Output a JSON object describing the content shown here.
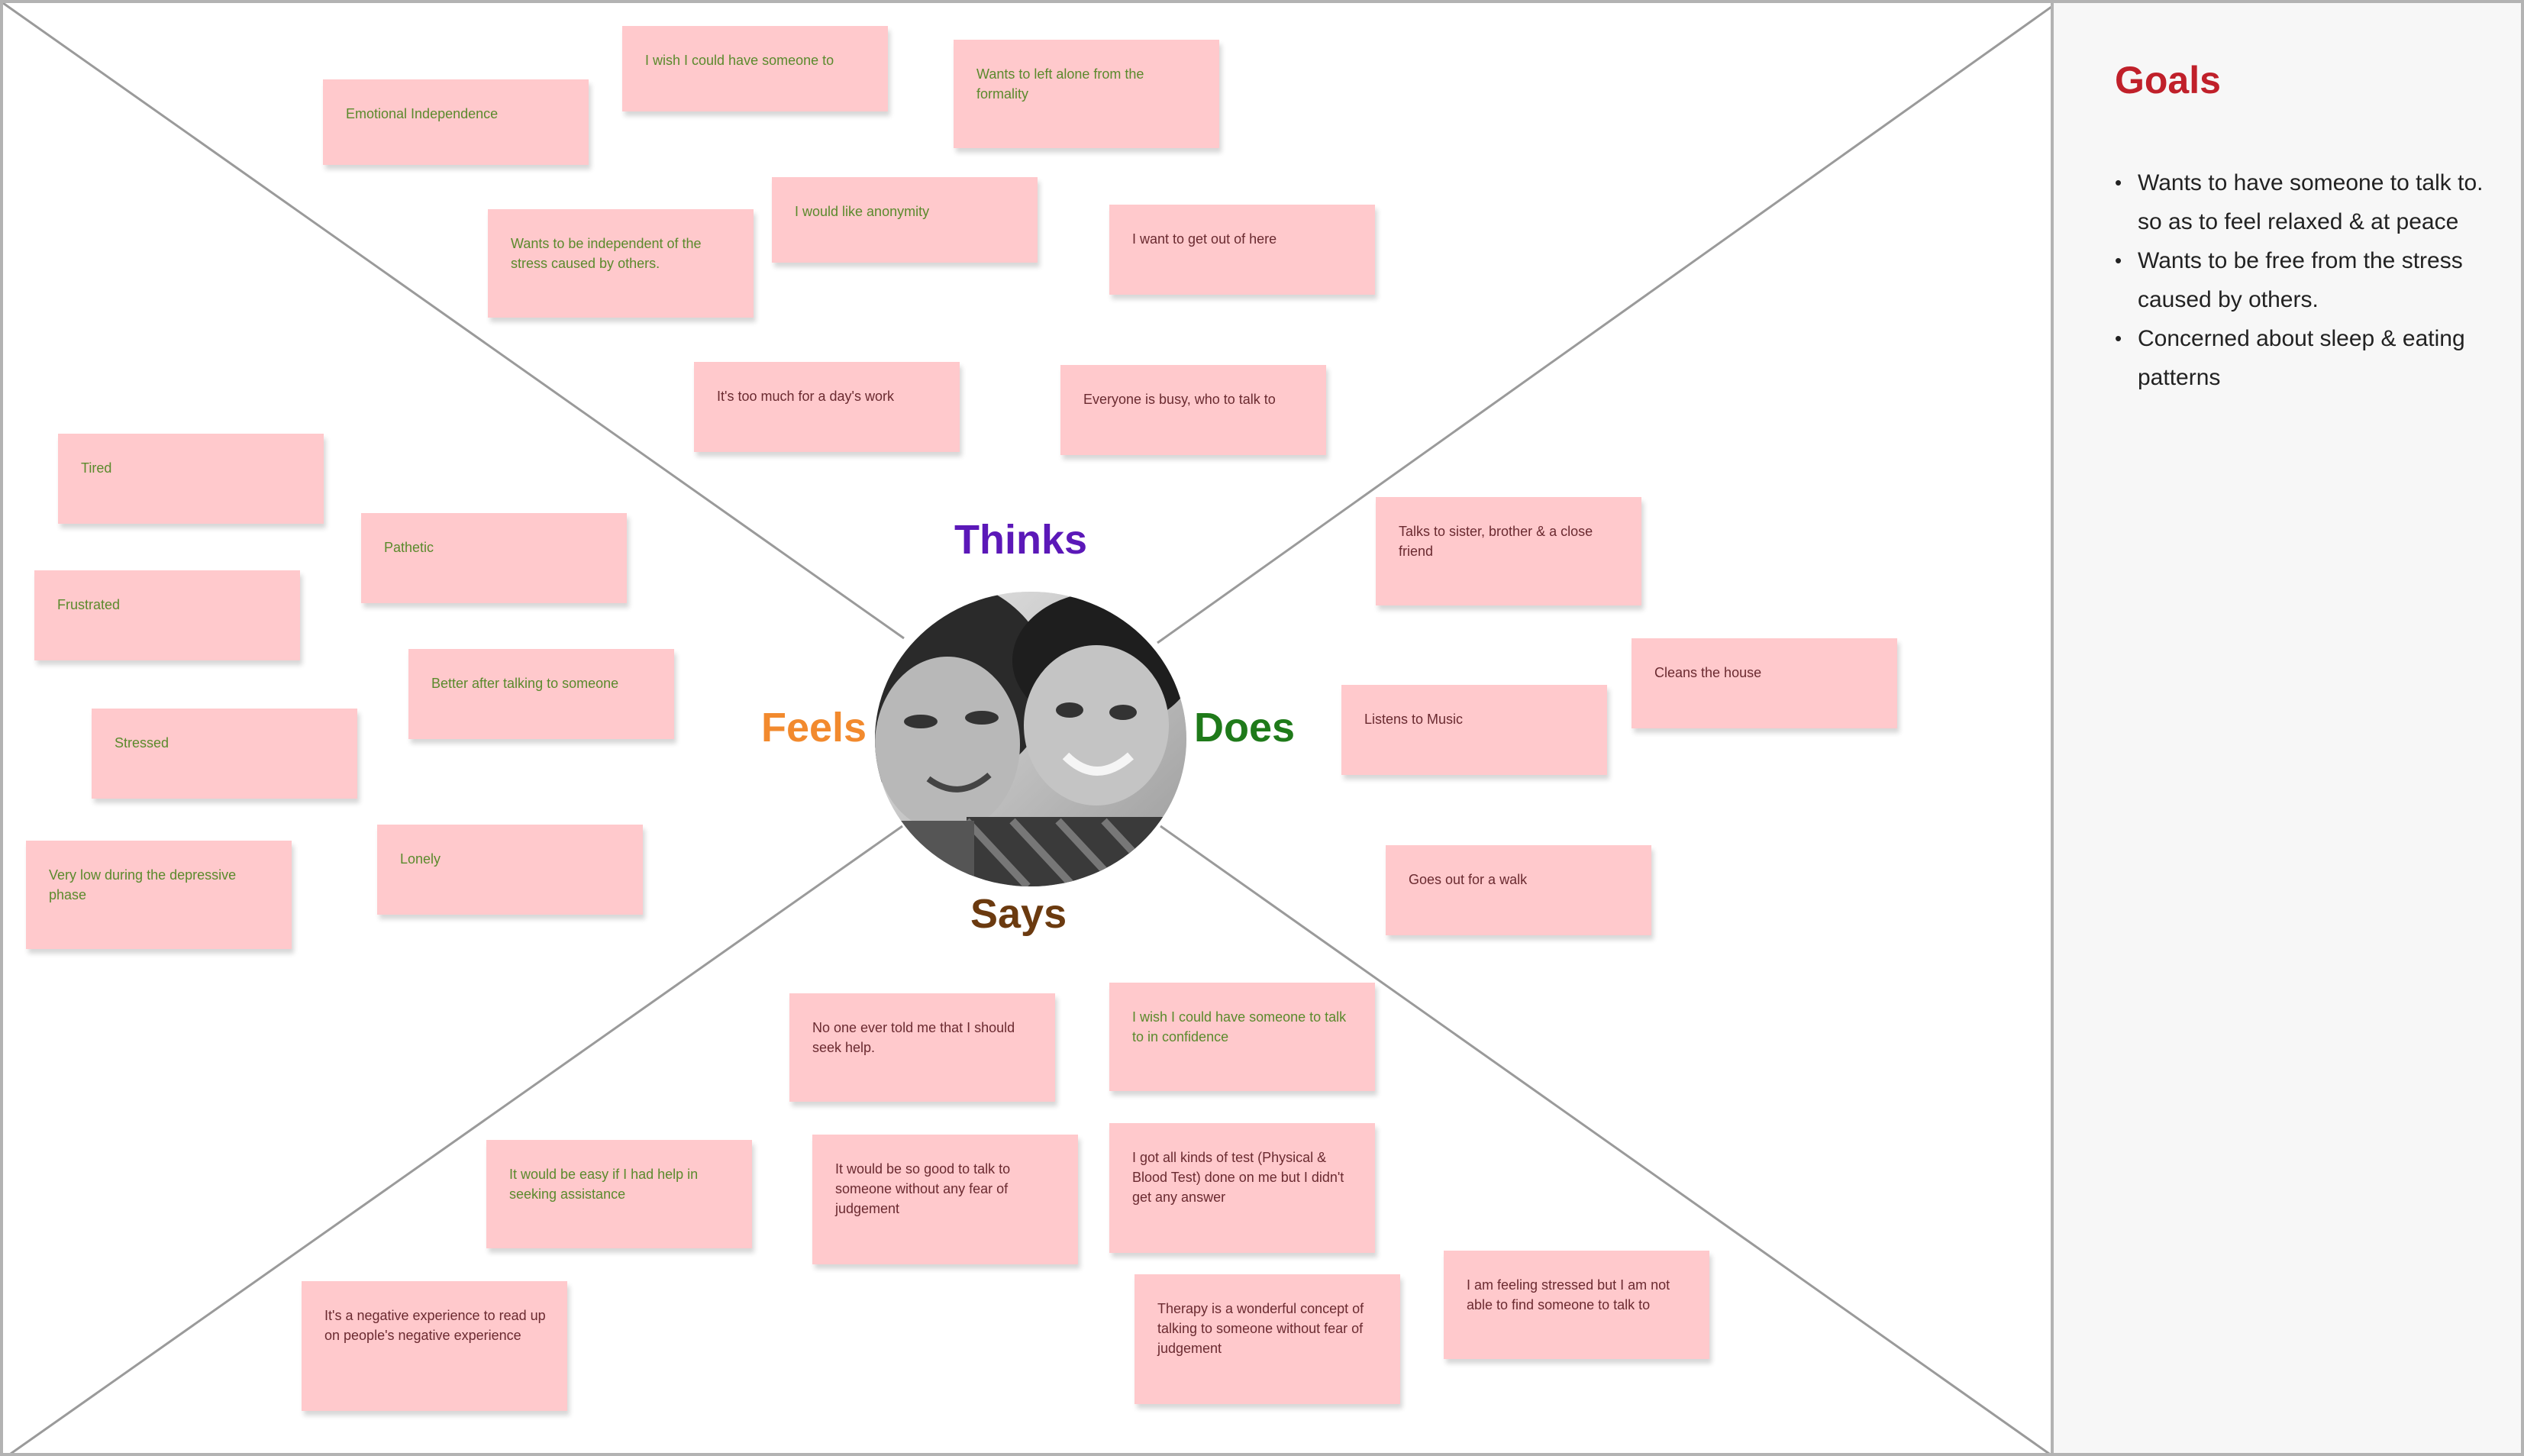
{
  "quadrants": {
    "thinks": "Thinks",
    "feels": "Feels",
    "does": "Does",
    "says": "Says"
  },
  "colors": {
    "thinks": "#5b18b8",
    "feels": "#f28a2e",
    "does": "#1f7a1a",
    "says": "#6b3a0f",
    "goals": "#c0202a",
    "note_bg": "#ffc9cc"
  },
  "notes": {
    "emotional_independence": "Emotional Independence",
    "wish_someone": "I wish I could have someone to",
    "left_alone": "Wants to left alone from the formality",
    "independent_stress": "Wants to be independent of the stress caused by others.",
    "anonymity": "I would like anonymity",
    "get_out": "I want to get out of here",
    "too_much": "It's too much for a day's work",
    "everyone_busy": "Everyone is busy, who to talk to",
    "tired": "Tired",
    "pathetic": "Pathetic",
    "frustrated": "Frustrated",
    "better_after": "Better after talking to someone",
    "stressed": "Stressed",
    "lonely": "Lonely",
    "very_low": "Very low during the depressive phase",
    "talks_to": "Talks to sister, brother & a close friend",
    "cleans": "Cleans the house",
    "music": "Listens to Music",
    "walk": "Goes out for a walk",
    "no_one_told": "No one ever told me that I should seek help.",
    "wish_confidence": "I wish I could have someone to talk to in confidence",
    "easy_help": "It would be easy if I had help in seeking assistance",
    "so_good": "It would be so good to talk to someone without any fear of judgement",
    "all_tests": "I got all kinds of test (Physical & Blood Test) done on me but I didn't get any answer",
    "negative_experience": "It's a negative experience to read up on people's negative experience",
    "therapy": "Therapy is a wonderful concept of talking to someone without fear of judgement",
    "feeling_stressed": "I am feeling stressed but I am not able to find someone to talk to"
  },
  "panel": {
    "title": "Goals",
    "goals": [
      "Wants to have someone to talk to. so as to feel relaxed & at peace",
      "Wants to be free from the stress caused by others.",
      "Concerned about sleep & eating patterns"
    ]
  }
}
